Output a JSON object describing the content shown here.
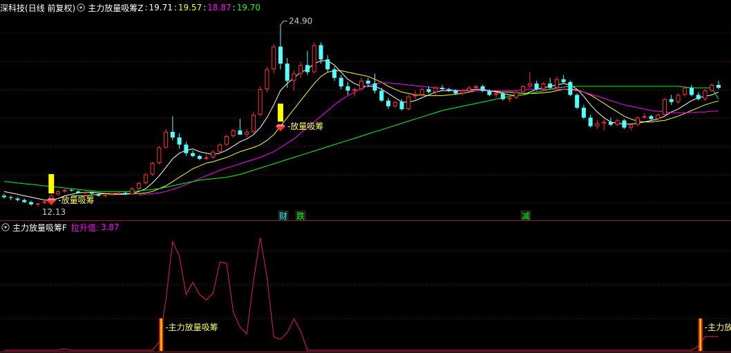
{
  "header_main": {
    "stock": "深科技",
    "period": "(日线 前复权)",
    "indicator": "主力放量吸筹Z",
    "values": [
      {
        "text": "19.71",
        "color": "#ffffff"
      },
      {
        "text": "19.57",
        "color": "#ffff00"
      },
      {
        "text": "18.87",
        "color": "#ff00ff"
      },
      {
        "text": "19.70",
        "color": "#00ff00"
      }
    ]
  },
  "header_sub": {
    "indicator": "主力放量吸筹F",
    "label": "拉升值:",
    "value": "3.87"
  },
  "chart_data": [
    {
      "type": "candlestick",
      "max_label": "24.90",
      "min_label": "12.13",
      "signal_label": "放量吸筹",
      "event_marks": [
        {
          "text": "财",
          "color": "#00ffff"
        },
        {
          "text": "跌",
          "color": "#00ff00"
        },
        {
          "text": "减",
          "color": "#00ff00"
        }
      ],
      "candles": [
        [
          12.9,
          13.05,
          12.7,
          12.8
        ],
        [
          12.8,
          12.9,
          12.6,
          12.75
        ],
        [
          12.7,
          12.8,
          12.5,
          12.6
        ],
        [
          12.6,
          12.7,
          12.4,
          12.45
        ],
        [
          12.45,
          12.55,
          12.2,
          12.3
        ],
        [
          12.3,
          12.4,
          12.13,
          12.35
        ],
        [
          12.4,
          12.6,
          12.3,
          12.5
        ],
        [
          12.6,
          13.0,
          12.5,
          12.9
        ],
        [
          13.0,
          13.3,
          12.9,
          13.2
        ],
        [
          13.2,
          13.4,
          13.1,
          13.3
        ],
        [
          13.3,
          13.4,
          13.2,
          13.25
        ],
        [
          13.2,
          13.3,
          13.05,
          13.1
        ],
        [
          13.1,
          13.2,
          13.0,
          13.15
        ],
        [
          13.15,
          13.2,
          13.0,
          13.05
        ],
        [
          13.0,
          13.1,
          12.85,
          12.9
        ],
        [
          12.9,
          13.0,
          12.8,
          12.95
        ],
        [
          12.95,
          13.1,
          12.9,
          13.05
        ],
        [
          13.05,
          13.15,
          13.0,
          13.1
        ],
        [
          13.1,
          13.2,
          12.95,
          13.0
        ],
        [
          13.0,
          13.5,
          12.95,
          13.4
        ],
        [
          13.4,
          13.9,
          13.3,
          13.8
        ],
        [
          13.8,
          14.5,
          13.7,
          14.4
        ],
        [
          14.4,
          15.3,
          14.3,
          15.2
        ],
        [
          15.2,
          16.4,
          15.1,
          16.3
        ],
        [
          16.3,
          17.6,
          16.2,
          17.4
        ],
        [
          17.4,
          18.5,
          16.8,
          17.0
        ],
        [
          17.0,
          17.3,
          16.2,
          16.5
        ],
        [
          16.5,
          16.7,
          15.7,
          15.9
        ],
        [
          15.9,
          16.1,
          15.6,
          15.7
        ],
        [
          15.7,
          15.8,
          15.4,
          15.5
        ],
        [
          15.5,
          15.8,
          15.4,
          15.6
        ],
        [
          15.6,
          16.1,
          15.5,
          16.0
        ],
        [
          16.0,
          16.6,
          15.9,
          16.5
        ],
        [
          16.5,
          17.2,
          16.4,
          17.1
        ],
        [
          17.1,
          17.6,
          17.0,
          17.5
        ],
        [
          17.5,
          18.3,
          17.3,
          17.2
        ],
        [
          17.2,
          17.6,
          17.0,
          17.4
        ],
        [
          17.4,
          18.8,
          17.3,
          18.6
        ],
        [
          18.6,
          20.6,
          18.5,
          20.4
        ],
        [
          20.4,
          22.0,
          20.2,
          21.8
        ],
        [
          21.8,
          23.6,
          21.5,
          23.4
        ],
        [
          23.4,
          24.9,
          21.8,
          22.2
        ],
        [
          22.2,
          22.6,
          20.5,
          21.0
        ],
        [
          21.0,
          21.7,
          20.3,
          21.5
        ],
        [
          21.5,
          22.3,
          21.2,
          22.1
        ],
        [
          22.1,
          23.1,
          21.4,
          21.6
        ],
        [
          21.6,
          23.7,
          21.5,
          23.5
        ],
        [
          23.5,
          23.7,
          22.2,
          22.5
        ],
        [
          22.5,
          22.8,
          21.6,
          21.8
        ],
        [
          21.8,
          22.0,
          21.0,
          21.2
        ],
        [
          21.2,
          21.4,
          20.4,
          20.6
        ],
        [
          20.6,
          20.9,
          20.0,
          20.3
        ],
        [
          20.3,
          20.5,
          19.9,
          20.4
        ],
        [
          20.4,
          21.2,
          20.3,
          21.0
        ],
        [
          21.0,
          21.2,
          20.6,
          20.8
        ],
        [
          20.8,
          21.5,
          20.1,
          20.3
        ],
        [
          20.3,
          20.5,
          19.5,
          19.6
        ],
        [
          19.6,
          19.8,
          19.0,
          19.2
        ],
        [
          19.2,
          19.6,
          19.1,
          19.5
        ],
        [
          19.5,
          19.7,
          18.9,
          19.0
        ],
        [
          19.0,
          20.0,
          18.9,
          19.9
        ],
        [
          19.9,
          20.3,
          19.7,
          20.0
        ],
        [
          20.0,
          20.5,
          19.9,
          20.4
        ],
        [
          20.4,
          20.6,
          20.1,
          20.2
        ],
        [
          20.2,
          20.6,
          20.0,
          20.5
        ],
        [
          20.5,
          20.7,
          20.3,
          20.4
        ],
        [
          20.4,
          20.5,
          20.2,
          20.3
        ],
        [
          20.3,
          20.4,
          20.0,
          20.1
        ],
        [
          20.1,
          20.4,
          20.0,
          20.3
        ],
        [
          20.3,
          20.6,
          20.2,
          20.5
        ],
        [
          20.5,
          20.7,
          20.4,
          20.6
        ],
        [
          20.6,
          20.7,
          20.2,
          20.3
        ],
        [
          20.3,
          20.4,
          19.9,
          20.0
        ],
        [
          20.0,
          20.2,
          19.8,
          20.1
        ],
        [
          20.1,
          20.2,
          19.6,
          19.7
        ],
        [
          19.7,
          19.9,
          19.5,
          19.8
        ],
        [
          19.8,
          20.3,
          19.7,
          20.2
        ],
        [
          20.2,
          20.7,
          20.1,
          20.6
        ],
        [
          20.6,
          21.6,
          20.5,
          20.8
        ],
        [
          20.8,
          21.0,
          20.3,
          20.4
        ],
        [
          20.4,
          20.9,
          20.3,
          20.8
        ],
        [
          20.8,
          21.2,
          20.4,
          20.5
        ],
        [
          20.5,
          21.3,
          20.4,
          21.1
        ],
        [
          21.1,
          21.4,
          20.8,
          20.9
        ],
        [
          20.9,
          21.0,
          19.9,
          20.0
        ],
        [
          20.0,
          20.1,
          19.0,
          19.1
        ],
        [
          19.1,
          19.3,
          18.3,
          18.4
        ],
        [
          18.4,
          18.6,
          17.7,
          17.8
        ],
        [
          17.8,
          18.2,
          17.6,
          18.0
        ],
        [
          18.0,
          18.3,
          17.5,
          18.1
        ],
        [
          18.1,
          18.4,
          17.8,
          17.9
        ],
        [
          17.9,
          18.3,
          17.8,
          18.2
        ],
        [
          18.2,
          18.3,
          17.6,
          17.7
        ],
        [
          17.7,
          18.0,
          17.5,
          17.9
        ],
        [
          17.9,
          18.5,
          17.8,
          18.4
        ],
        [
          18.4,
          18.7,
          18.3,
          18.5
        ],
        [
          18.5,
          18.6,
          18.2,
          18.3
        ],
        [
          18.3,
          18.7,
          18.2,
          18.6
        ],
        [
          18.6,
          19.8,
          18.5,
          19.7
        ],
        [
          19.7,
          20.0,
          19.3,
          19.5
        ],
        [
          19.5,
          20.1,
          19.4,
          20.0
        ],
        [
          20.0,
          20.6,
          19.9,
          20.5
        ],
        [
          20.5,
          20.7,
          19.9,
          20.0
        ],
        [
          20.0,
          20.2,
          19.6,
          19.7
        ],
        [
          19.7,
          20.4,
          19.6,
          20.3
        ],
        [
          20.3,
          20.8,
          20.2,
          20.7
        ],
        [
          20.7,
          21.0,
          20.4,
          20.5
        ]
      ],
      "ma_lines": [
        {
          "name": "ma-white",
          "color": "#ffffff",
          "values": [
            13.2,
            13.1,
            13.0,
            12.9,
            12.8,
            12.7,
            12.6,
            12.6,
            12.7,
            12.9,
            13.0,
            13.1,
            13.15,
            13.15,
            13.1,
            13.05,
            13.0,
            13.0,
            13.0,
            13.05,
            13.2,
            13.4,
            13.8,
            14.3,
            14.9,
            15.5,
            15.9,
            16.1,
            16.2,
            16.0,
            15.9,
            15.8,
            15.9,
            16.1,
            16.4,
            16.7,
            16.9,
            17.2,
            17.7,
            18.4,
            19.3,
            20.3,
            20.8,
            21.2,
            21.6,
            21.8,
            22.2,
            22.4,
            22.4,
            22.1,
            21.6,
            21.1,
            20.8,
            20.6,
            20.6,
            20.6,
            20.4,
            20.1,
            19.8,
            19.5,
            19.5,
            19.6,
            19.8,
            20.0,
            20.2,
            20.3,
            20.3,
            20.3,
            20.3,
            20.35,
            20.4,
            20.4,
            20.3,
            20.2,
            20.1,
            20.0,
            19.95,
            20.0,
            20.2,
            20.4,
            20.5,
            20.6,
            20.7,
            20.8,
            20.7,
            20.4,
            19.9,
            19.3,
            18.8,
            18.4,
            18.1,
            18.0,
            17.95,
            17.95,
            18.0,
            18.1,
            18.2,
            18.3,
            18.5,
            18.8,
            19.0,
            19.3,
            19.6,
            19.8,
            19.9,
            20.0,
            20.2
          ]
        },
        {
          "name": "ma-yellow",
          "color": "#ffff00",
          "values": [
            null,
            null,
            null,
            null,
            null,
            null,
            null,
            null,
            null,
            null,
            12.9,
            12.9,
            12.9,
            12.95,
            13.0,
            13.05,
            13.05,
            13.05,
            13.05,
            13.05,
            13.05,
            13.1,
            13.2,
            13.4,
            13.6,
            13.9,
            14.2,
            14.5,
            14.8,
            15.0,
            15.2,
            15.3,
            15.45,
            15.6,
            15.8,
            16.0,
            16.15,
            16.3,
            16.5,
            16.8,
            17.2,
            17.8,
            18.4,
            19.0,
            19.6,
            20.2,
            20.8,
            21.3,
            21.6,
            21.7,
            21.7,
            21.6,
            21.5,
            21.4,
            21.3,
            21.1,
            20.9,
            20.6,
            20.4,
            20.2,
            20.1,
            20.0,
            20.0,
            19.95,
            19.95,
            19.95,
            20.0,
            20.05,
            20.1,
            20.2,
            20.3,
            20.3,
            20.3,
            20.25,
            20.2,
            20.2,
            20.15,
            20.1,
            20.1,
            20.1,
            20.15,
            20.2,
            20.3,
            20.4,
            20.4,
            20.35,
            20.2,
            20.0,
            19.7,
            19.4,
            19.1,
            18.8,
            18.5,
            18.3,
            18.15,
            18.1,
            18.1,
            18.15,
            18.2,
            18.35,
            18.5,
            18.7,
            18.9,
            19.1,
            19.3,
            19.45,
            19.57
          ]
        },
        {
          "name": "ma-magenta",
          "color": "#ff00ff",
          "values": [
            null,
            null,
            null,
            null,
            null,
            null,
            null,
            null,
            null,
            null,
            null,
            null,
            null,
            null,
            null,
            null,
            null,
            null,
            null,
            null,
            12.95,
            13.0,
            13.05,
            13.1,
            13.2,
            13.35,
            13.5,
            13.7,
            13.9,
            14.1,
            14.3,
            14.5,
            14.7,
            14.85,
            15.0,
            15.15,
            15.3,
            15.45,
            15.6,
            15.8,
            16.0,
            16.3,
            16.6,
            16.9,
            17.3,
            17.7,
            18.1,
            18.5,
            18.9,
            19.3,
            19.65,
            19.95,
            20.2,
            20.45,
            20.65,
            20.8,
            20.85,
            20.85,
            20.8,
            20.75,
            20.7,
            20.65,
            20.6,
            20.55,
            20.5,
            20.45,
            20.4,
            20.35,
            20.3,
            20.3,
            20.3,
            20.3,
            20.3,
            20.3,
            20.3,
            20.3,
            20.3,
            20.35,
            20.4,
            20.4,
            20.4,
            20.4,
            20.4,
            20.4,
            20.35,
            20.3,
            20.2,
            20.05,
            19.9,
            19.75,
            19.6,
            19.45,
            19.3,
            19.2,
            19.1,
            19.0,
            18.9,
            18.85,
            18.8,
            18.75,
            18.75,
            18.75,
            18.75,
            18.8,
            18.8,
            18.85,
            18.87
          ]
        },
        {
          "name": "ma-green",
          "color": "#00ff00",
          "values": [
            13.9,
            13.85,
            13.8,
            13.75,
            13.7,
            13.65,
            13.6,
            13.55,
            13.5,
            13.45,
            13.4,
            13.35,
            13.3,
            13.25,
            13.2,
            13.2,
            13.2,
            13.2,
            13.2,
            13.2,
            13.25,
            13.3,
            13.35,
            13.4,
            13.5,
            13.6,
            13.7,
            13.8,
            13.9,
            14.0,
            14.05,
            14.1,
            14.15,
            14.2,
            14.3,
            14.4,
            14.55,
            14.7,
            14.85,
            15.0,
            15.15,
            15.3,
            15.45,
            15.6,
            15.75,
            15.9,
            16.05,
            16.2,
            16.35,
            16.5,
            16.65,
            16.8,
            16.95,
            17.1,
            17.25,
            17.4,
            17.55,
            17.7,
            17.85,
            18.0,
            18.15,
            18.3,
            18.45,
            18.6,
            18.75,
            18.9,
            19.0,
            19.1,
            19.2,
            19.3,
            19.4,
            19.5,
            19.6,
            19.7,
            19.8,
            19.9,
            19.95,
            20.0,
            20.1,
            20.2,
            20.3,
            20.4,
            20.5,
            20.55,
            20.6,
            20.6,
            20.6,
            20.6,
            20.6,
            20.6,
            20.6,
            20.6,
            20.6,
            20.6,
            20.6,
            20.6,
            20.6,
            20.6,
            20.6,
            20.6,
            20.6,
            20.55,
            20.5,
            20.5,
            20.5,
            20.5,
            19.7
          ]
        }
      ]
    },
    {
      "type": "line",
      "series_name": "拉升值",
      "color": "#e0196e",
      "threshold": 1.0,
      "ylim": [
        0,
        9
      ],
      "values": [
        0,
        0,
        0,
        0,
        0,
        0,
        0,
        0,
        0,
        0.1,
        0,
        0,
        0,
        0,
        0,
        0,
        0,
        0,
        0,
        0,
        0,
        0,
        0,
        0.6,
        3.7,
        8.0,
        6.9,
        4.1,
        5.0,
        4.1,
        3.7,
        4.2,
        6.5,
        6.4,
        2.8,
        1.7,
        1.2,
        5.1,
        8.3,
        5.4,
        1.0,
        0.8,
        1.3,
        2.3,
        1.4,
        0,
        0,
        0,
        0,
        0,
        0,
        0,
        0,
        0,
        0,
        0,
        0,
        0,
        0,
        0,
        0,
        0,
        0,
        0,
        0,
        0,
        0,
        0,
        0,
        0,
        0,
        0,
        0,
        0,
        0,
        0,
        0,
        0,
        0,
        0,
        0,
        0,
        0,
        0,
        0,
        0,
        0,
        0,
        0,
        0,
        0,
        0,
        0,
        0,
        0,
        0,
        0,
        0,
        0,
        0,
        0,
        0,
        0.0,
        0.3,
        1.0,
        1.0,
        1.0
      ],
      "signal_label": "主力放量吸筹"
    }
  ]
}
